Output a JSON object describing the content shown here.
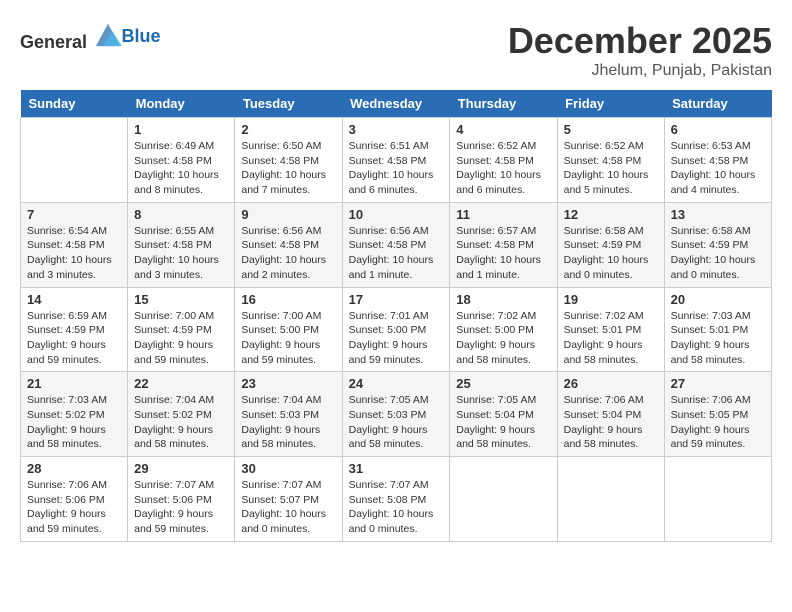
{
  "header": {
    "logo_general": "General",
    "logo_blue": "Blue",
    "month": "December 2025",
    "location": "Jhelum, Punjab, Pakistan"
  },
  "days": [
    "Sunday",
    "Monday",
    "Tuesday",
    "Wednesday",
    "Thursday",
    "Friday",
    "Saturday"
  ],
  "weeks": [
    [
      {
        "date": "",
        "info": ""
      },
      {
        "date": "1",
        "info": "Sunrise: 6:49 AM\nSunset: 4:58 PM\nDaylight: 10 hours\nand 8 minutes."
      },
      {
        "date": "2",
        "info": "Sunrise: 6:50 AM\nSunset: 4:58 PM\nDaylight: 10 hours\nand 7 minutes."
      },
      {
        "date": "3",
        "info": "Sunrise: 6:51 AM\nSunset: 4:58 PM\nDaylight: 10 hours\nand 6 minutes."
      },
      {
        "date": "4",
        "info": "Sunrise: 6:52 AM\nSunset: 4:58 PM\nDaylight: 10 hours\nand 6 minutes."
      },
      {
        "date": "5",
        "info": "Sunrise: 6:52 AM\nSunset: 4:58 PM\nDaylight: 10 hours\nand 5 minutes."
      },
      {
        "date": "6",
        "info": "Sunrise: 6:53 AM\nSunset: 4:58 PM\nDaylight: 10 hours\nand 4 minutes."
      }
    ],
    [
      {
        "date": "7",
        "info": "Sunrise: 6:54 AM\nSunset: 4:58 PM\nDaylight: 10 hours\nand 3 minutes."
      },
      {
        "date": "8",
        "info": "Sunrise: 6:55 AM\nSunset: 4:58 PM\nDaylight: 10 hours\nand 3 minutes."
      },
      {
        "date": "9",
        "info": "Sunrise: 6:56 AM\nSunset: 4:58 PM\nDaylight: 10 hours\nand 2 minutes."
      },
      {
        "date": "10",
        "info": "Sunrise: 6:56 AM\nSunset: 4:58 PM\nDaylight: 10 hours\nand 1 minute."
      },
      {
        "date": "11",
        "info": "Sunrise: 6:57 AM\nSunset: 4:58 PM\nDaylight: 10 hours\nand 1 minute."
      },
      {
        "date": "12",
        "info": "Sunrise: 6:58 AM\nSunset: 4:59 PM\nDaylight: 10 hours\nand 0 minutes."
      },
      {
        "date": "13",
        "info": "Sunrise: 6:58 AM\nSunset: 4:59 PM\nDaylight: 10 hours\nand 0 minutes."
      }
    ],
    [
      {
        "date": "14",
        "info": "Sunrise: 6:59 AM\nSunset: 4:59 PM\nDaylight: 9 hours\nand 59 minutes."
      },
      {
        "date": "15",
        "info": "Sunrise: 7:00 AM\nSunset: 4:59 PM\nDaylight: 9 hours\nand 59 minutes."
      },
      {
        "date": "16",
        "info": "Sunrise: 7:00 AM\nSunset: 5:00 PM\nDaylight: 9 hours\nand 59 minutes."
      },
      {
        "date": "17",
        "info": "Sunrise: 7:01 AM\nSunset: 5:00 PM\nDaylight: 9 hours\nand 59 minutes."
      },
      {
        "date": "18",
        "info": "Sunrise: 7:02 AM\nSunset: 5:00 PM\nDaylight: 9 hours\nand 58 minutes."
      },
      {
        "date": "19",
        "info": "Sunrise: 7:02 AM\nSunset: 5:01 PM\nDaylight: 9 hours\nand 58 minutes."
      },
      {
        "date": "20",
        "info": "Sunrise: 7:03 AM\nSunset: 5:01 PM\nDaylight: 9 hours\nand 58 minutes."
      }
    ],
    [
      {
        "date": "21",
        "info": "Sunrise: 7:03 AM\nSunset: 5:02 PM\nDaylight: 9 hours\nand 58 minutes."
      },
      {
        "date": "22",
        "info": "Sunrise: 7:04 AM\nSunset: 5:02 PM\nDaylight: 9 hours\nand 58 minutes."
      },
      {
        "date": "23",
        "info": "Sunrise: 7:04 AM\nSunset: 5:03 PM\nDaylight: 9 hours\nand 58 minutes."
      },
      {
        "date": "24",
        "info": "Sunrise: 7:05 AM\nSunset: 5:03 PM\nDaylight: 9 hours\nand 58 minutes."
      },
      {
        "date": "25",
        "info": "Sunrise: 7:05 AM\nSunset: 5:04 PM\nDaylight: 9 hours\nand 58 minutes."
      },
      {
        "date": "26",
        "info": "Sunrise: 7:06 AM\nSunset: 5:04 PM\nDaylight: 9 hours\nand 58 minutes."
      },
      {
        "date": "27",
        "info": "Sunrise: 7:06 AM\nSunset: 5:05 PM\nDaylight: 9 hours\nand 59 minutes."
      }
    ],
    [
      {
        "date": "28",
        "info": "Sunrise: 7:06 AM\nSunset: 5:06 PM\nDaylight: 9 hours\nand 59 minutes."
      },
      {
        "date": "29",
        "info": "Sunrise: 7:07 AM\nSunset: 5:06 PM\nDaylight: 9 hours\nand 59 minutes."
      },
      {
        "date": "30",
        "info": "Sunrise: 7:07 AM\nSunset: 5:07 PM\nDaylight: 10 hours\nand 0 minutes."
      },
      {
        "date": "31",
        "info": "Sunrise: 7:07 AM\nSunset: 5:08 PM\nDaylight: 10 hours\nand 0 minutes."
      },
      {
        "date": "",
        "info": ""
      },
      {
        "date": "",
        "info": ""
      },
      {
        "date": "",
        "info": ""
      }
    ]
  ]
}
